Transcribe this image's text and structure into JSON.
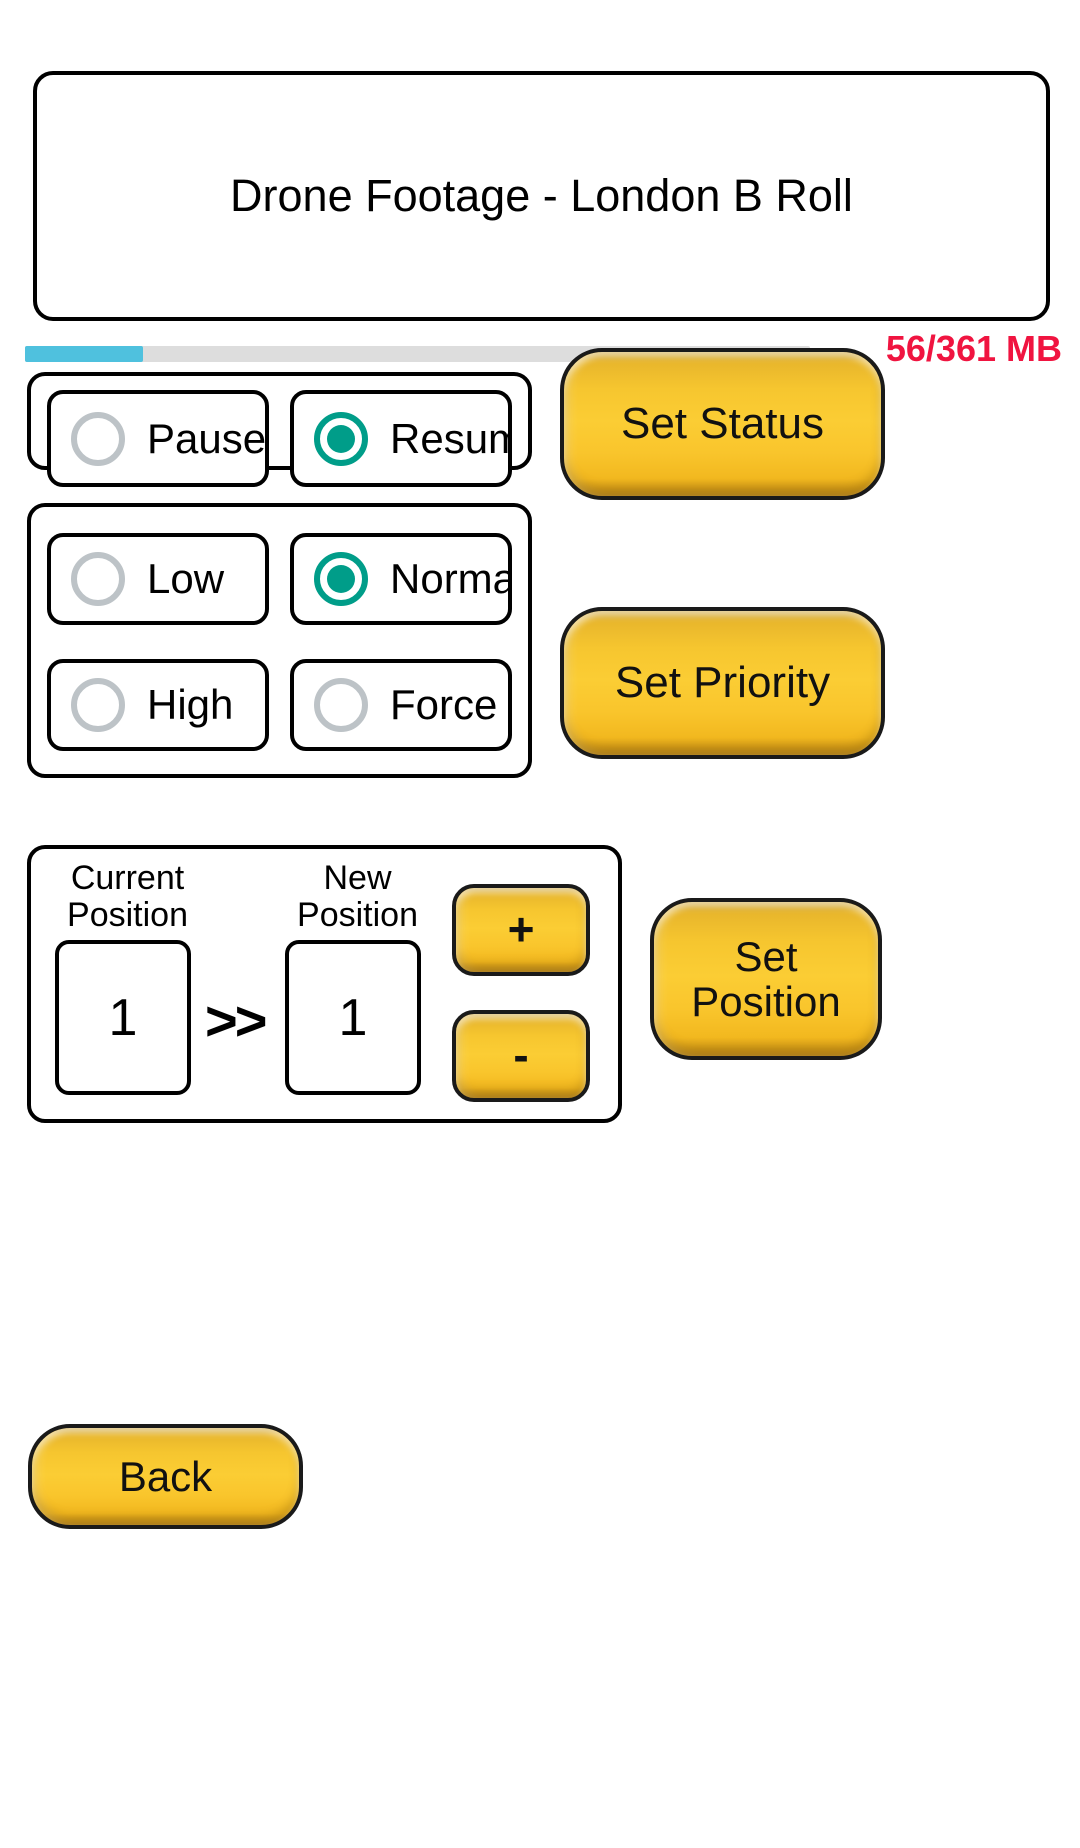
{
  "title": {
    "text": "Drone Footage - London B Roll"
  },
  "progress": {
    "percent": 15,
    "label": "56/361 MB",
    "fill_color": "#4fc1de",
    "track_color": "#dddddd",
    "label_color": "#f01440"
  },
  "status_group": {
    "options": [
      {
        "label": "Pause",
        "selected": false
      },
      {
        "label": "Resume",
        "selected": true
      }
    ],
    "action": {
      "label": "Set Status"
    }
  },
  "priority_group": {
    "options": [
      {
        "label": "Low",
        "selected": false
      },
      {
        "label": "Normal",
        "selected": true
      },
      {
        "label": "High",
        "selected": false
      },
      {
        "label": "Force",
        "selected": false
      }
    ],
    "action": {
      "label": "Set Priority"
    }
  },
  "position_group": {
    "current_caption": "Current\nPosition",
    "new_caption": "New\nPosition",
    "current_value": "1",
    "new_value": "1",
    "arrow": ">>",
    "increment_label": "+",
    "decrement_label": "-",
    "action": {
      "label": "Set\nPosition"
    }
  },
  "footer": {
    "back_label": "Back"
  },
  "theme": {
    "accent_teal": "#009d89",
    "radio_off": "#bdc3c7",
    "gold_mid": "#fbcd34",
    "gold_edge": "#c08a14",
    "outline": "#000000"
  }
}
